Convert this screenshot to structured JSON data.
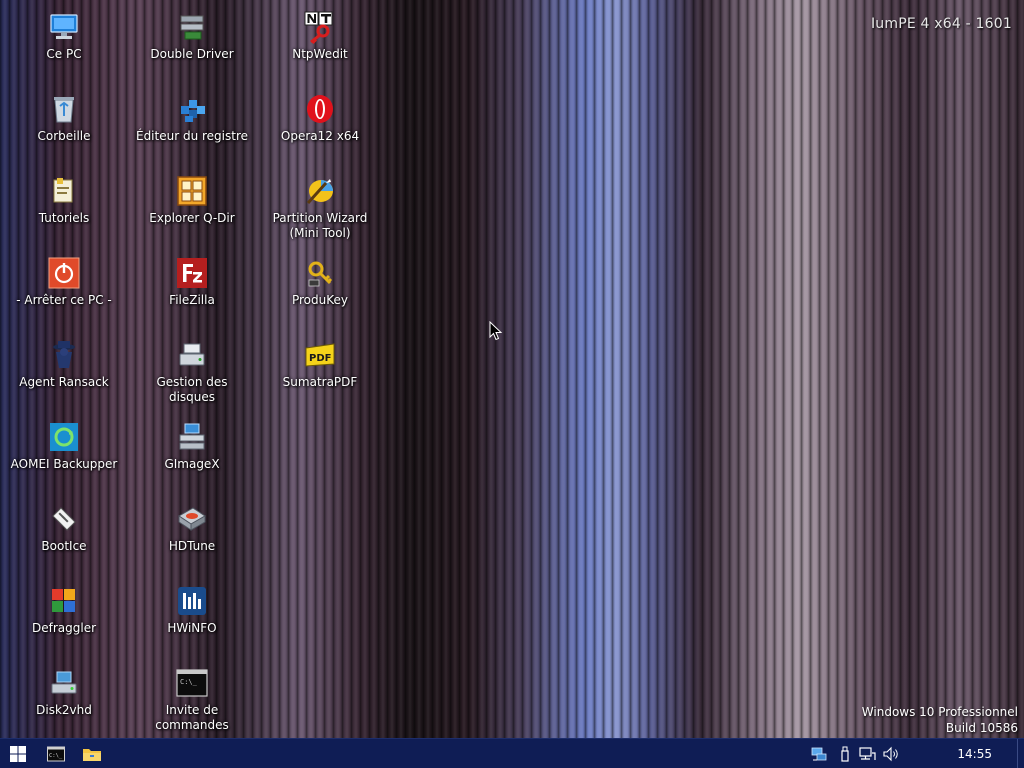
{
  "watermark": {
    "title": "IumPE 4 x64 - 1601",
    "os_name": "Windows 10 Professionnel",
    "build": "Build 10586"
  },
  "desktop_icons": [
    {
      "label": "Ce PC",
      "icon": "computer-icon"
    },
    {
      "label": "Corbeille",
      "icon": "recycle-bin-icon"
    },
    {
      "label": "Tutoriels",
      "icon": "tutorials-folder-icon"
    },
    {
      "label": "- Arrêter ce PC -",
      "icon": "power-icon"
    },
    {
      "label": "Agent Ransack",
      "icon": "agent-ransack-icon"
    },
    {
      "label": "AOMEI Backupper",
      "icon": "aomei-backupper-icon"
    },
    {
      "label": "BootIce",
      "icon": "bootice-icon"
    },
    {
      "label": "Defraggler",
      "icon": "defraggler-icon"
    },
    {
      "label": "Disk2vhd",
      "icon": "disk2vhd-icon"
    },
    {
      "label": "Double Driver",
      "icon": "double-driver-icon"
    },
    {
      "label": "Éditeur du registre",
      "icon": "registry-editor-icon"
    },
    {
      "label": "Explorer Q-Dir",
      "icon": "q-dir-icon"
    },
    {
      "label": "FileZilla",
      "icon": "filezilla-icon"
    },
    {
      "label": "Gestion des disques",
      "icon": "disk-management-icon"
    },
    {
      "label": "GImageX",
      "icon": "gimagex-icon"
    },
    {
      "label": "HDTune",
      "icon": "hdtune-icon"
    },
    {
      "label": "HWiNFO",
      "icon": "hwinfo-icon"
    },
    {
      "label": "Invite de commandes",
      "icon": "command-prompt-icon"
    },
    {
      "label": "NtpWedit",
      "icon": "ntpwedit-icon"
    },
    {
      "label": "Opera12 x64",
      "icon": "opera-icon"
    },
    {
      "label": "Partition Wizard (Mini Tool)",
      "icon": "partition-wizard-icon"
    },
    {
      "label": "ProduKey",
      "icon": "produkey-icon"
    },
    {
      "label": "SumatraPDF",
      "icon": "sumatrapdf-icon"
    }
  ],
  "taskbar": {
    "start_icon": "windows-start-icon",
    "pinned": [
      {
        "name": "command-prompt",
        "icon": "cmd-icon"
      },
      {
        "name": "file-explorer",
        "icon": "folder-icon"
      }
    ],
    "tray": [
      {
        "name": "network-share",
        "icon": "network-share-icon"
      },
      {
        "name": "usb",
        "icon": "usb-icon"
      },
      {
        "name": "network",
        "icon": "network-icon"
      },
      {
        "name": "volume",
        "icon": "speaker-icon"
      }
    ],
    "clock": "14:55"
  },
  "colors": {
    "taskbar": "#0f1d55",
    "icon_text": "#ffffff"
  }
}
